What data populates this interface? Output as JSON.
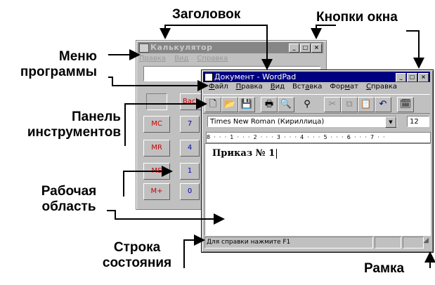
{
  "callouts": {
    "title": "Заголовок",
    "window_buttons": "Кнопки окна",
    "menu_line1": "Меню",
    "menu_line2": "программы",
    "toolbar_line1": "Панель",
    "toolbar_line2": "инструментов",
    "workarea_line1": "Рабочая",
    "workarea_line2": "область",
    "status_line1": "Строка",
    "status_line2": "состояния",
    "frame": "Рамка"
  },
  "calculator": {
    "title": "Калькулятор",
    "menu": [
      "Правка",
      "Вид",
      "Справка"
    ],
    "back_button": "Back",
    "memory_buttons": [
      "MC",
      "MR",
      "MS",
      "M+"
    ],
    "digit_buttons": [
      "7",
      "4",
      "1",
      "0"
    ]
  },
  "wordpad": {
    "title": "Документ - WordPad",
    "menu": [
      {
        "pre": "",
        "ul": "Ф",
        "post": "айл"
      },
      {
        "pre": "",
        "ul": "П",
        "post": "равка"
      },
      {
        "pre": "",
        "ul": "В",
        "post": "ид"
      },
      {
        "pre": "Вст",
        "ul": "а",
        "post": "вка"
      },
      {
        "pre": "Фор",
        "ul": "м",
        "post": "ат"
      },
      {
        "pre": "",
        "ul": "С",
        "post": "правка"
      }
    ],
    "toolbar_icons": [
      "new-document-icon",
      "open-folder-icon",
      "save-disk-icon",
      "print-icon",
      "print-preview-icon",
      "find-binoculars-icon",
      "cut-scissors-icon",
      "copy-icon",
      "paste-icon",
      "undo-icon",
      "datetime-icon"
    ],
    "font_name": "Times New Roman (Кириллица)",
    "font_size": "12",
    "ruler_text": "8 · · · 1 · · · 2 · · · 3 · · · 4 · · · 5 · · · 6 · · · 7 · ·",
    "document_text": "Приказ № 1",
    "status_text": "Для справки нажмите F1"
  }
}
